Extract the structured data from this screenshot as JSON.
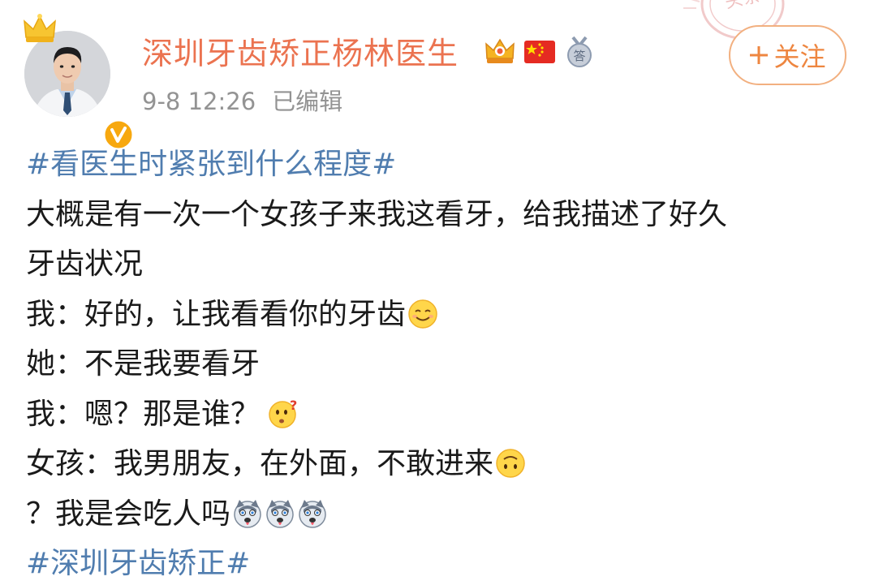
{
  "header": {
    "username": "深圳牙齿矫正杨林医生",
    "timestamp": "9-8 12:26",
    "edited_label": "已编辑",
    "follow_label": "关注",
    "badges": [
      "crown-badge-icon",
      "china-flag-icon",
      "answer-medal-icon"
    ],
    "verified_icon": "verified-v-icon",
    "stamp_text": "头条"
  },
  "post": {
    "lines": [
      {
        "text": "#看医生时紧张到什么程度#",
        "type": "hashtag"
      },
      {
        "text": "大概是有一次一个女孩子来我这看牙，给我描述了好久牙齿状况",
        "type": "text"
      },
      {
        "text": "我：好的，让我看看你的牙齿",
        "type": "text",
        "emoji": "smile"
      },
      {
        "text": "她：不是我要看牙",
        "type": "text"
      },
      {
        "text": "我：嗯？那是谁？",
        "type": "text",
        "emoji": "confused"
      },
      {
        "text": "女孩：我男朋友，在外面，不敢进来",
        "type": "text",
        "emoji": "upside-down"
      },
      {
        "text": "？我是会吃人吗",
        "type": "text",
        "emoji": "husky-x3"
      },
      {
        "text": "#深圳牙齿矫正#",
        "type": "hashtag"
      }
    ],
    "line_1a": "大概是有一次一个女孩子来我这看牙，给我描述了好久",
    "line_1b": "牙齿状况"
  },
  "colors": {
    "username": "#eb7350",
    "hashtag": "#507daf",
    "meta": "#939393",
    "follow": "#ee8640"
  }
}
